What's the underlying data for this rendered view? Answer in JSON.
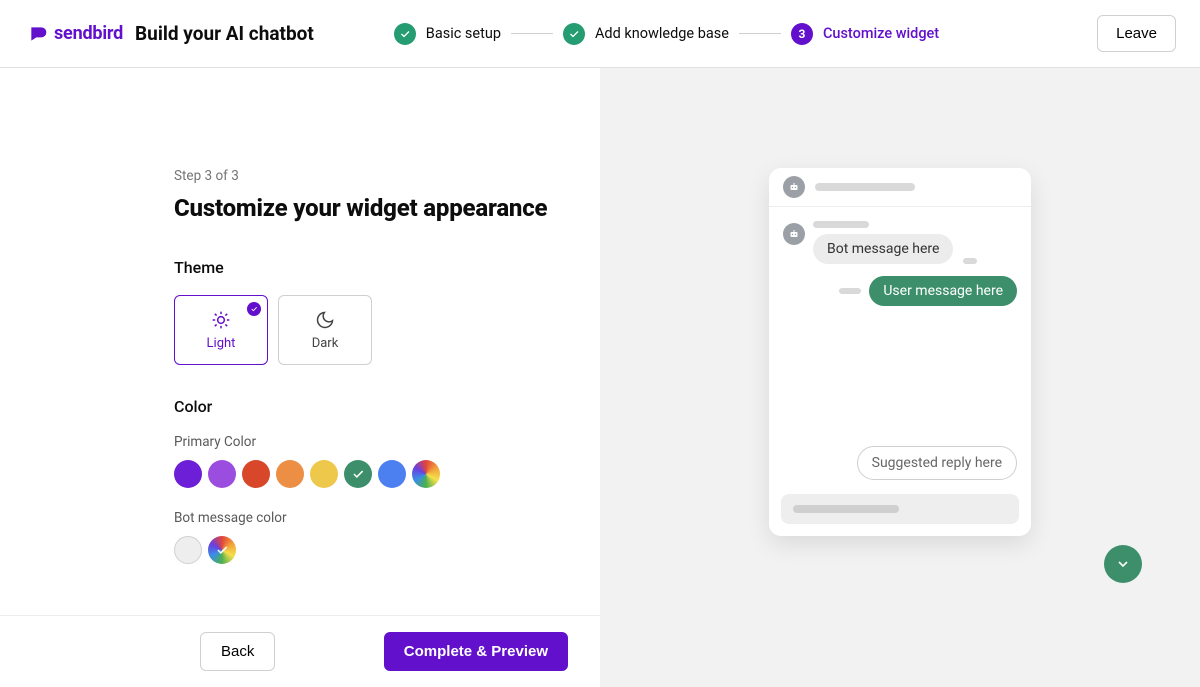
{
  "header": {
    "brand": "sendbird",
    "title": "Build your AI chatbot",
    "steps": [
      {
        "label": "Basic setup",
        "state": "done"
      },
      {
        "label": "Add knowledge base",
        "state": "done"
      },
      {
        "label": "Customize widget",
        "state": "current",
        "number": "3"
      }
    ],
    "leave": "Leave"
  },
  "page": {
    "step_of": "Step 3 of 3",
    "heading": "Customize your widget appearance",
    "theme": {
      "label": "Theme",
      "options": [
        {
          "key": "light",
          "label": "Light",
          "selected": true
        },
        {
          "key": "dark",
          "label": "Dark",
          "selected": false
        }
      ]
    },
    "color": {
      "label": "Color",
      "primary": {
        "label": "Primary Color",
        "swatches": [
          {
            "hex": "#6c1fd6",
            "selected": false
          },
          {
            "hex": "#9b4de0",
            "selected": false
          },
          {
            "hex": "#d9472b",
            "selected": false
          },
          {
            "hex": "#ec8f45",
            "selected": false
          },
          {
            "hex": "#eec84a",
            "selected": false
          },
          {
            "hex": "#3c8f6a",
            "selected": true
          },
          {
            "hex": "#4c7ff0",
            "selected": false
          },
          {
            "hex": "rainbow",
            "selected": false
          }
        ]
      },
      "bot": {
        "label": "Bot message color",
        "swatches": [
          {
            "hex": "#eeeeee",
            "selected": false,
            "stroke": true
          },
          {
            "hex": "rainbow",
            "selected": true
          }
        ]
      }
    },
    "footer": {
      "back": "Back",
      "primary": "Complete & Preview"
    }
  },
  "preview": {
    "bot_message": "Bot message here",
    "user_message": "User message here",
    "suggested": "Suggested reply here",
    "accent": "#3c8f6a"
  }
}
